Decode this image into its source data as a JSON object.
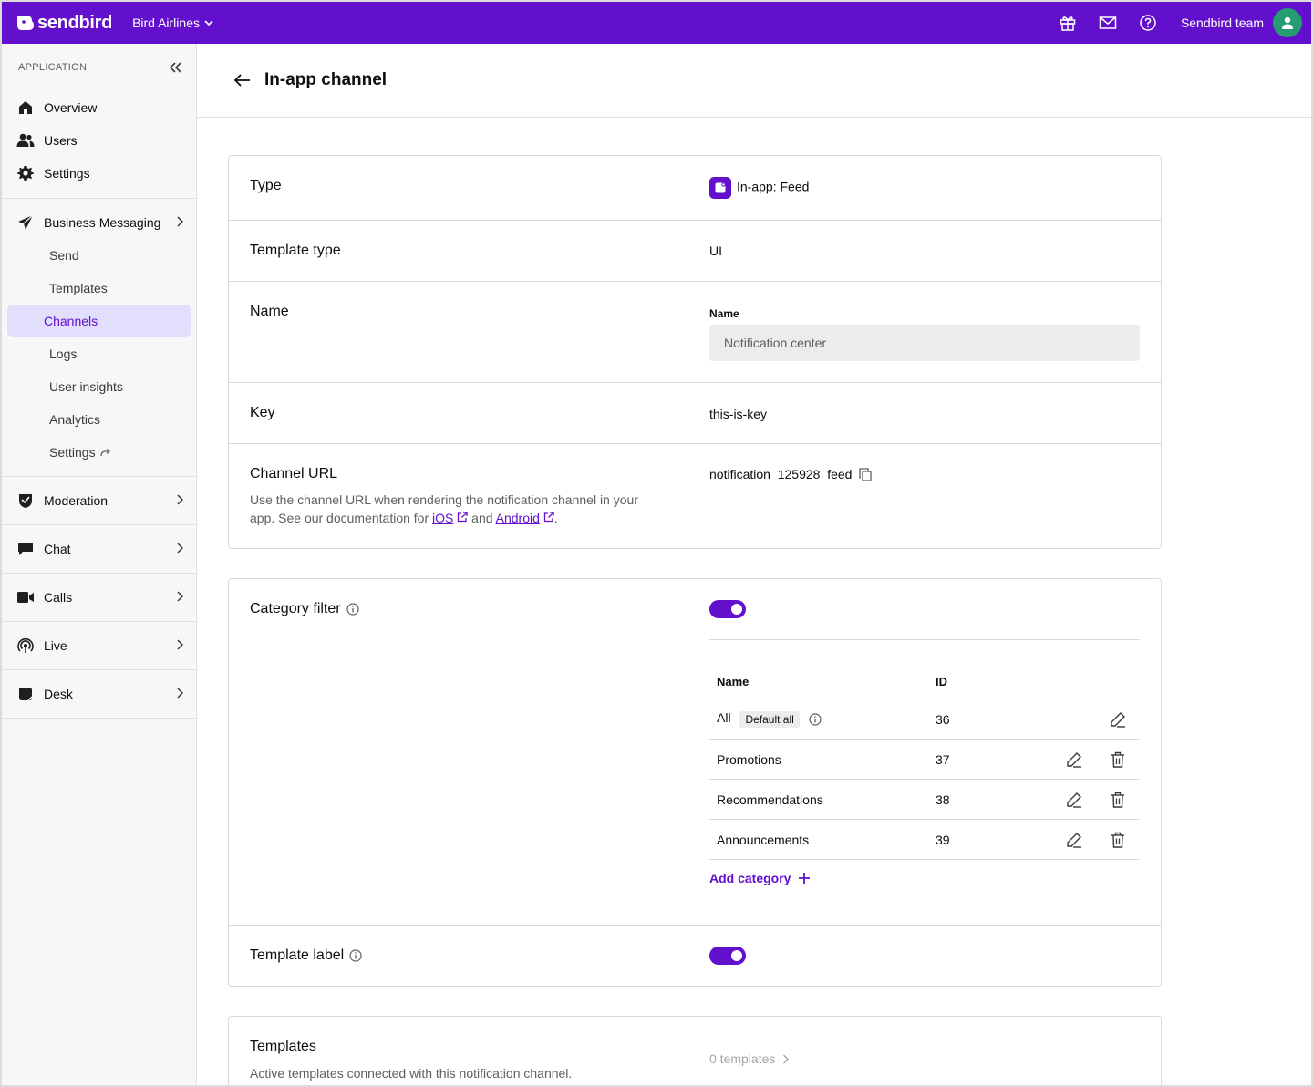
{
  "brand": {
    "name": "sendbird",
    "accent": "#6210cc"
  },
  "topbar": {
    "app_name": "Bird Airlines",
    "team_name": "Sendbird team",
    "icons": [
      "gift-icon",
      "mail-icon",
      "help-icon"
    ]
  },
  "sidebar": {
    "section_label": "APPLICATION",
    "items": [
      {
        "label": "Overview",
        "icon": "home-icon"
      },
      {
        "label": "Users",
        "icon": "users-icon"
      },
      {
        "label": "Settings",
        "icon": "gear-icon"
      }
    ],
    "business_messaging": {
      "label": "Business Messaging",
      "sub": [
        "Send",
        "Templates",
        "Channels",
        "Logs",
        "User insights",
        "Analytics",
        "Settings"
      ],
      "active": "Channels"
    },
    "groups": [
      {
        "label": "Moderation",
        "icon": "moderation-icon"
      },
      {
        "label": "Chat",
        "icon": "chat-icon"
      },
      {
        "label": "Calls",
        "icon": "video-icon"
      },
      {
        "label": "Live",
        "icon": "live-icon"
      },
      {
        "label": "Desk",
        "icon": "desk-icon"
      }
    ]
  },
  "page": {
    "title": "In-app channel"
  },
  "details": {
    "type_label": "Type",
    "type_value": "In-app: Feed",
    "template_type_label": "Template type",
    "template_type_value": "UI",
    "name_label": "Name",
    "name_field_label": "Name",
    "name_value": "Notification center",
    "key_label": "Key",
    "key_value": "this-is-key",
    "channel_url_label": "Channel URL",
    "channel_url_value": "notification_125928_feed",
    "channel_url_desc_1": "Use the channel URL when rendering the notification channel in your",
    "channel_url_desc_2": "app. See our documentation for",
    "ios_link": "iOS",
    "and_text": "and",
    "android_link": "Android",
    "period": "."
  },
  "category_filter": {
    "label": "Category filter",
    "enabled": true,
    "columns": {
      "name": "Name",
      "id": "ID"
    },
    "rows": [
      {
        "name": "All",
        "badge": "Default all",
        "id": "36"
      },
      {
        "name": "Promotions",
        "id": "37"
      },
      {
        "name": "Recommendations",
        "id": "38"
      },
      {
        "name": "Announcements",
        "id": "39"
      }
    ],
    "add_label": "Add category"
  },
  "template_label": {
    "label": "Template label",
    "enabled": true
  },
  "templates": {
    "label": "Templates",
    "desc": "Active templates connected with this notification channel.",
    "count": "0 templates"
  }
}
